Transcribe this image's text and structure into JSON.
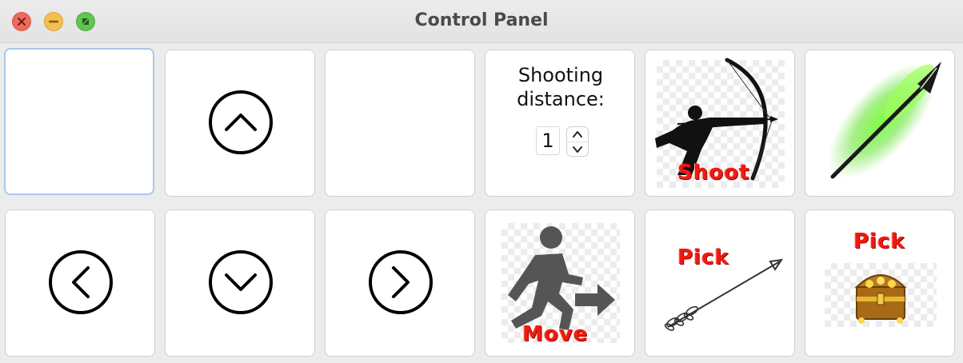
{
  "window": {
    "title": "Control Panel",
    "controls": [
      "close",
      "minimize",
      "zoom"
    ]
  },
  "grid": {
    "row1": [
      {
        "name": "blank-button",
        "icon": ""
      },
      {
        "name": "move-up-button",
        "icon": "chevron-up-circle-icon"
      },
      {
        "name": "blank-button",
        "icon": ""
      },
      {
        "name": "shooting-distance-panel",
        "icon": ""
      },
      {
        "name": "shoot-button",
        "icon": "archer-icon"
      },
      {
        "name": "arrow-image-button",
        "icon": "glowing-arrow-icon"
      }
    ],
    "row2": [
      {
        "name": "move-left-button",
        "icon": "chevron-left-circle-icon"
      },
      {
        "name": "move-down-button",
        "icon": "chevron-down-circle-icon"
      },
      {
        "name": "move-right-button",
        "icon": "chevron-right-circle-icon"
      },
      {
        "name": "move-button",
        "icon": "running-man-icon"
      },
      {
        "name": "pick-arrow-button",
        "icon": "arrow-icon"
      },
      {
        "name": "pick-treasure-button",
        "icon": "treasure-chest-icon"
      }
    ]
  },
  "shooting": {
    "label_line1": "Shooting",
    "label_line2": "distance:",
    "value": "1"
  },
  "labels": {
    "shoot": "Shoot",
    "move": "Move",
    "pick_arrow": "Pick",
    "pick_treasure": "Pick"
  },
  "colors": {
    "label_red": "#f01a10",
    "focus_ring": "#a9c7ea",
    "glow_green": "#5ee32a"
  }
}
